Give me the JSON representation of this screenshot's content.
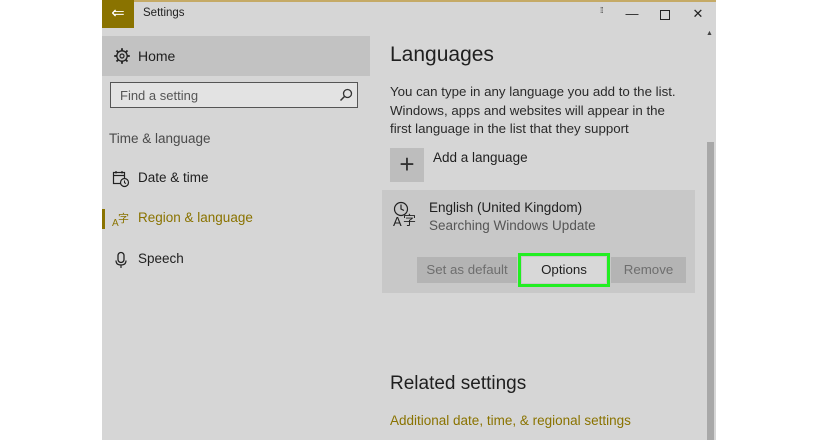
{
  "window": {
    "app_title": "Settings",
    "back_glyph": "⇐",
    "grip_glyph": "⁞⁞",
    "min_glyph": "—",
    "close_glyph": "✕"
  },
  "sidebar": {
    "home_label": "Home",
    "search_placeholder": "Find a setting",
    "section_label": "Time & language",
    "items": [
      {
        "label": "Date & time",
        "icon": "calendar-clock-icon"
      },
      {
        "label": "Region & language",
        "icon": "region-language-icon"
      },
      {
        "label": "Speech",
        "icon": "microphone-icon"
      }
    ],
    "accent_color": "#8a7300"
  },
  "main": {
    "title": "Languages",
    "description": "You can type in any language you add to the list. Windows, apps and websites will appear in the first language in the list that they support",
    "add_language_label": "Add a language",
    "language": {
      "name": "English (United Kingdom)",
      "status": "Searching Windows Update"
    },
    "buttons": {
      "set_default": "Set as default",
      "options": "Options",
      "remove": "Remove"
    },
    "highlight_color": "#22ee22",
    "related_title": "Related settings",
    "related_link": "Additional date, time, & regional settings"
  }
}
